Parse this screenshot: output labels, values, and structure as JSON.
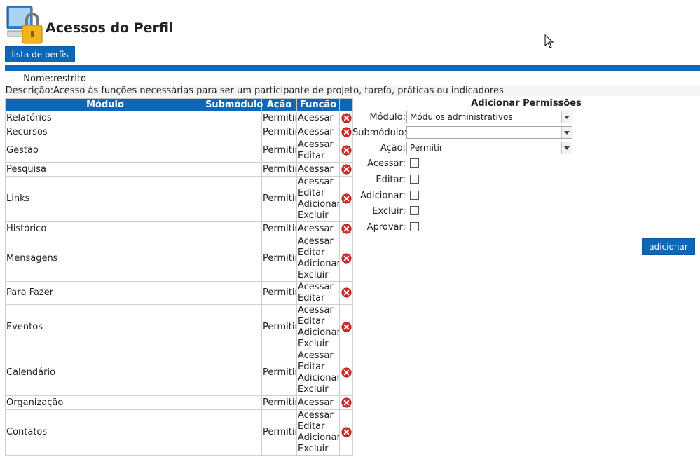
{
  "header": {
    "title": "Acessos do Perfil",
    "logo_icon": "computer-lock-icon"
  },
  "buttons": {
    "list_profiles": "lista de perfis",
    "add": "adicionar"
  },
  "profile": {
    "name_label": "Nome:",
    "name": "restrito",
    "desc_label": "Descrição:",
    "description": "Acesso às funções necessárias para ser um participante de projeto, tarefa, práticas ou indicadores"
  },
  "table": {
    "headers": {
      "module": "Módulo",
      "submodule": "Submódulo",
      "action": "Ação",
      "function": "Função"
    },
    "rows": [
      {
        "module": "Relatórios",
        "submodule": "",
        "action": "Permitir",
        "functions": [
          "Acessar"
        ]
      },
      {
        "module": "Recursos",
        "submodule": "",
        "action": "Permitir",
        "functions": [
          "Acessar"
        ]
      },
      {
        "module": "Gestão",
        "submodule": "",
        "action": "Permitir",
        "functions": [
          "Acessar",
          "Editar"
        ]
      },
      {
        "module": "Pesquisa",
        "submodule": "",
        "action": "Permitir",
        "functions": [
          "Acessar"
        ]
      },
      {
        "module": "Links",
        "submodule": "",
        "action": "Permitir",
        "functions": [
          "Acessar",
          "Editar",
          "Adicionar",
          "Excluir"
        ]
      },
      {
        "module": "Histórico",
        "submodule": "",
        "action": "Permitir",
        "functions": [
          "Acessar"
        ]
      },
      {
        "module": "Mensagens",
        "submodule": "",
        "action": "Permitir",
        "functions": [
          "Acessar",
          "Editar",
          "Adicionar",
          "Excluir"
        ]
      },
      {
        "module": "Para Fazer",
        "submodule": "",
        "action": "Permitir",
        "functions": [
          "Acessar",
          "Editar"
        ]
      },
      {
        "module": "Eventos",
        "submodule": "",
        "action": "Permitir",
        "functions": [
          "Acessar",
          "Editar",
          "Adicionar",
          "Excluir"
        ]
      },
      {
        "module": "Calendário",
        "submodule": "",
        "action": "Permitir",
        "functions": [
          "Acessar",
          "Editar",
          "Adicionar",
          "Excluir"
        ]
      },
      {
        "module": "Organização",
        "submodule": "",
        "action": "Permitir",
        "functions": [
          "Acessar"
        ]
      },
      {
        "module": "Contatos",
        "submodule": "",
        "action": "Permitir",
        "functions": [
          "Acessar",
          "Editar",
          "Adicionar",
          "Excluir"
        ]
      }
    ]
  },
  "add_panel": {
    "title": "Adicionar Permissões",
    "module_label": "Módulo:",
    "module_value": "Módulos administrativos",
    "submodule_label": "Submódulo:",
    "submodule_value": "",
    "action_label": "Ação:",
    "action_value": "Permitir",
    "checkboxes": [
      {
        "label": "Acessar:",
        "checked": false
      },
      {
        "label": "Editar:",
        "checked": false
      },
      {
        "label": "Adicionar:",
        "checked": false
      },
      {
        "label": "Excluir:",
        "checked": false
      },
      {
        "label": "Aprovar:",
        "checked": false
      }
    ]
  },
  "colors": {
    "accent": "#0a67b9",
    "delete": "#e02a2a"
  }
}
